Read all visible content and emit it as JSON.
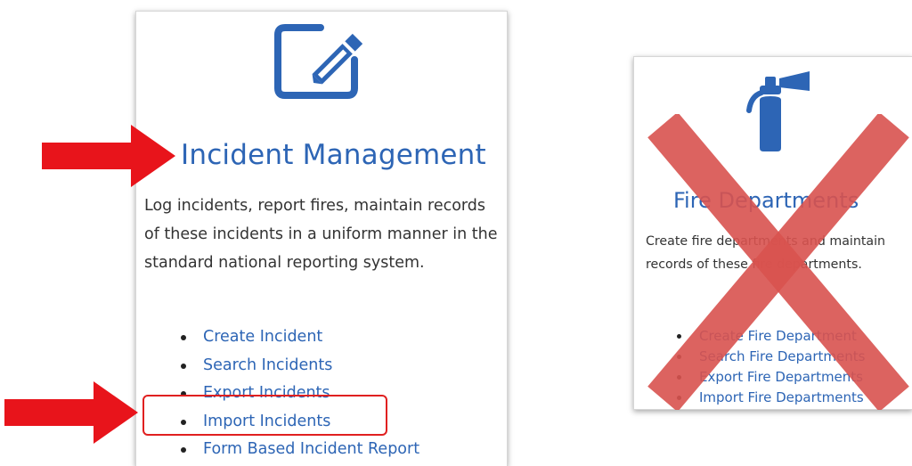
{
  "incident_card": {
    "title": "Incident Management",
    "description": "Log incidents, report fires, maintain records of these incidents in a uniform manner in the standard national reporting system.",
    "links": [
      "Create Incident",
      "Search Incidents",
      "Export Incidents",
      "Import Incidents",
      "Form Based Incident Report"
    ],
    "icon": "edit-icon"
  },
  "fire_card": {
    "title": "Fire Departments",
    "description": "Create fire departments and maintain records of these fire departments.",
    "links": [
      "Create Fire Department",
      "Search Fire Departments",
      "Export Fire Departments",
      "Import Fire Departments"
    ],
    "icon": "fire-extinguisher-icon"
  },
  "annotations": {
    "arrow_color": "#e8141b",
    "highlight_color": "#e02020",
    "cross_color": "#d9534f"
  },
  "colors": {
    "link": "#2d65b5",
    "text": "#333333"
  }
}
